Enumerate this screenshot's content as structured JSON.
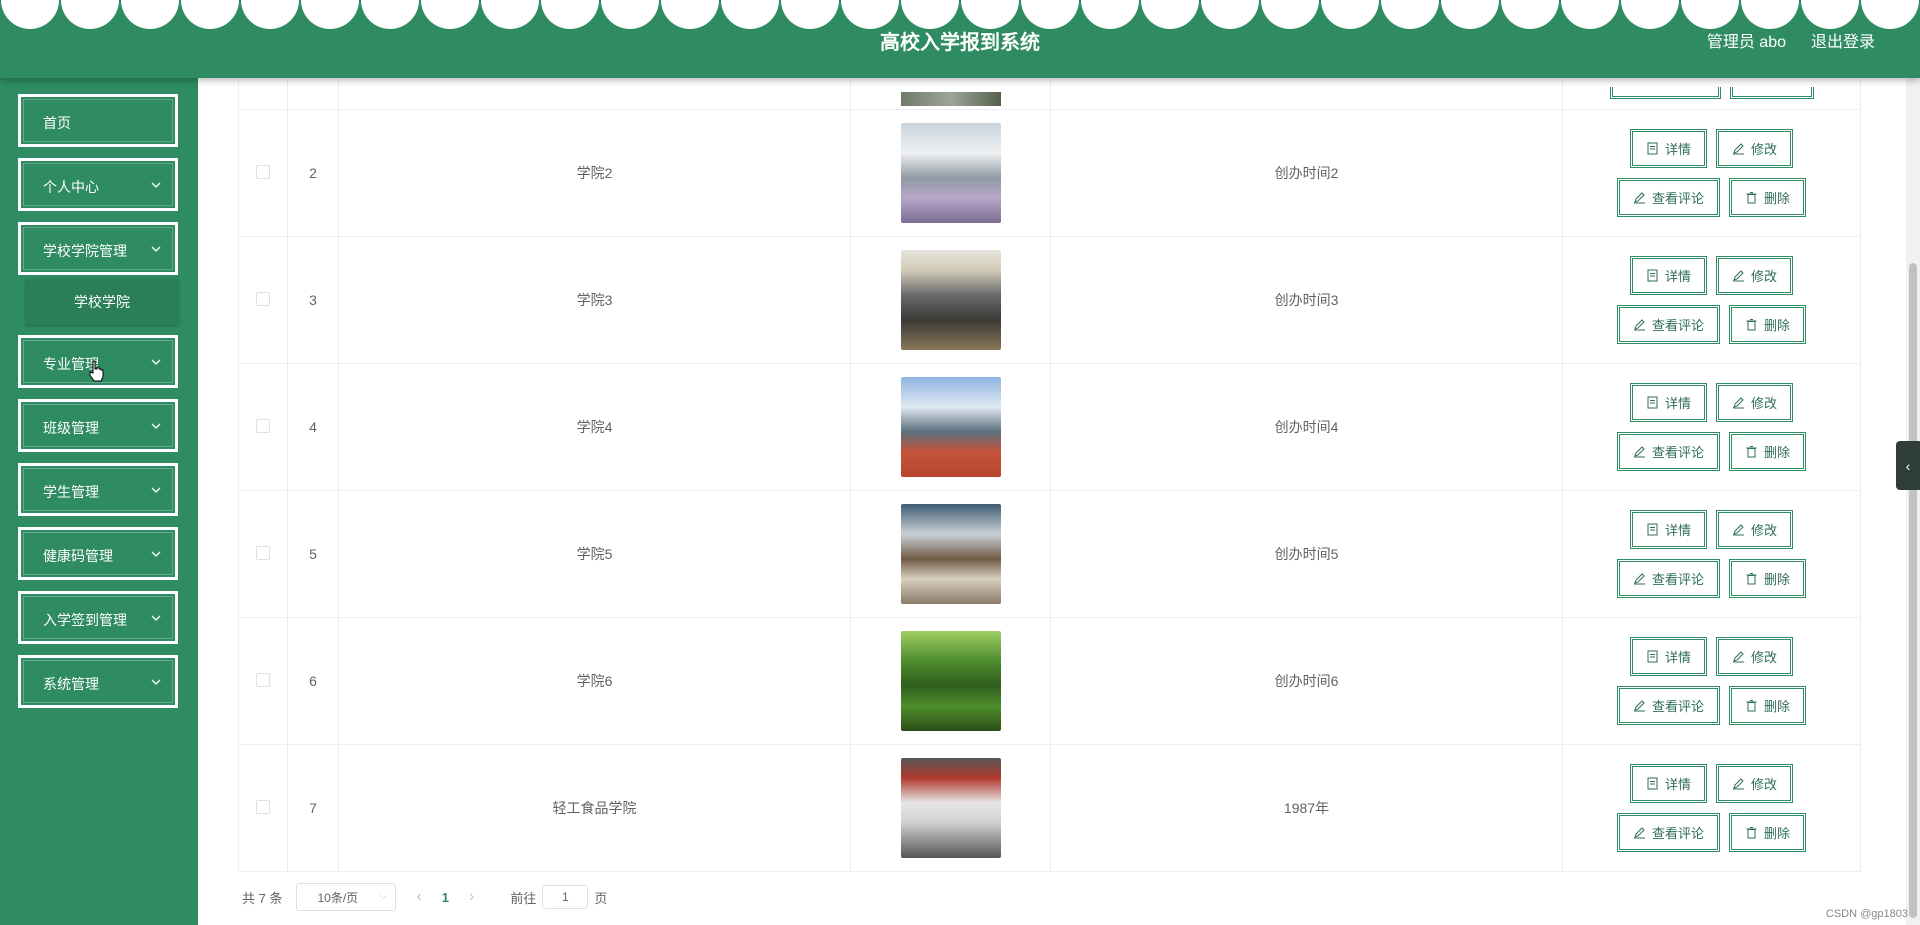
{
  "header": {
    "title": "高校入学报到系统",
    "user": "管理员 abo",
    "logout": "退出登录"
  },
  "sidebar": {
    "items": [
      {
        "label": "首页",
        "has_children": false
      },
      {
        "label": "个人中心",
        "has_children": true
      },
      {
        "label": "学校学院管理",
        "has_children": true
      },
      {
        "label": "专业管理",
        "has_children": true
      },
      {
        "label": "班级管理",
        "has_children": true
      },
      {
        "label": "学生管理",
        "has_children": true
      },
      {
        "label": "健康码管理",
        "has_children": true
      },
      {
        "label": "入学签到管理",
        "has_children": true
      },
      {
        "label": "系统管理",
        "has_children": true
      }
    ],
    "open_submenu": {
      "parent": "学校学院管理",
      "item": "学校学院"
    }
  },
  "table": {
    "rows": [
      {
        "index": "2",
        "name": "学院2",
        "founded": "创办时间2",
        "image": "building-courtyard"
      },
      {
        "index": "3",
        "name": "学院3",
        "founded": "创办时间3",
        "image": "meeting-room"
      },
      {
        "index": "4",
        "name": "学院4",
        "founded": "创办时间4",
        "image": "running-track"
      },
      {
        "index": "5",
        "name": "学院5",
        "founded": "创办时间5",
        "image": "classroom"
      },
      {
        "index": "6",
        "name": "学院6",
        "founded": "创办时间6",
        "image": "tree-path"
      },
      {
        "index": "7",
        "name": "轻工食品学院",
        "founded": "1987年",
        "image": "campus-event"
      }
    ],
    "actions": {
      "detail": "详情",
      "edit": "修改",
      "comments": "查看评论",
      "delete": "删除"
    }
  },
  "pagination": {
    "total": "共 7 条",
    "page_size": "10条/页",
    "current_page": "1",
    "goto_prefix": "前往",
    "goto_value": "1",
    "goto_suffix": "页"
  },
  "colors": {
    "primary": "#2e8b62",
    "header_bg": "#2e8b62"
  },
  "watermark": "CSDN @gp1803"
}
